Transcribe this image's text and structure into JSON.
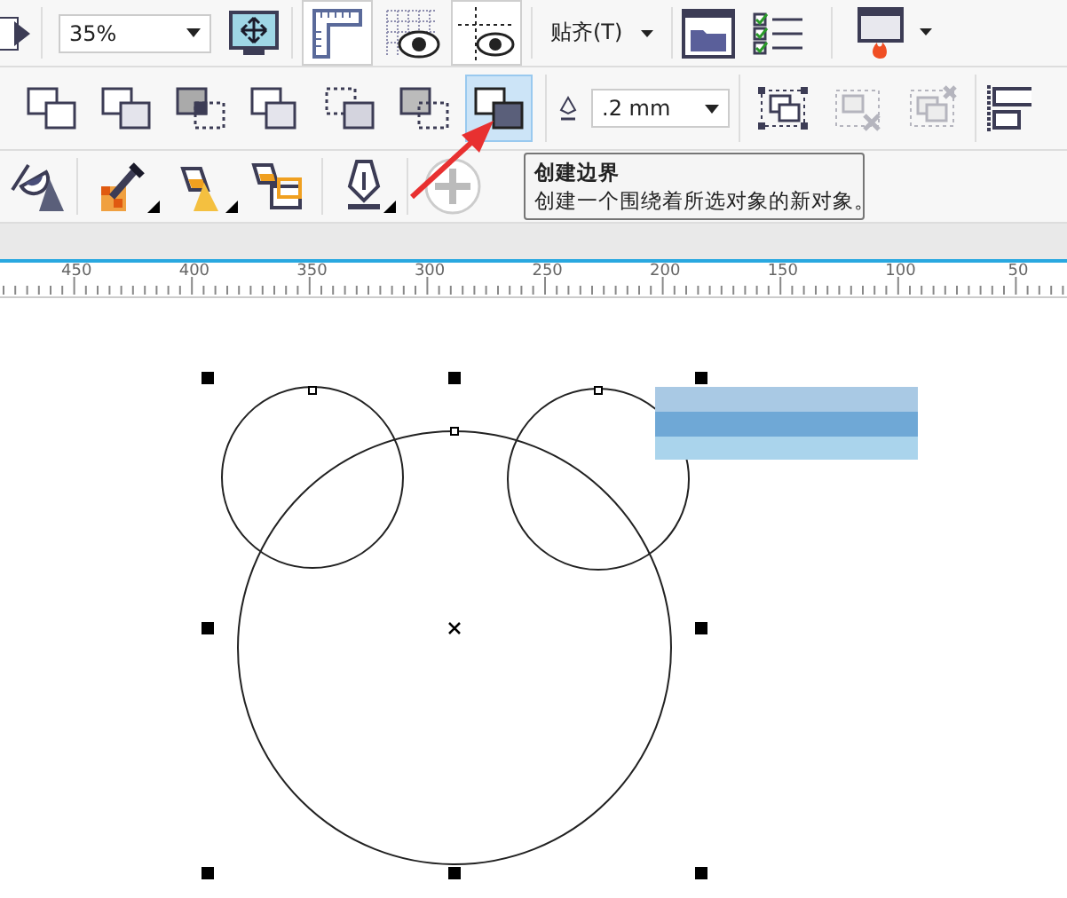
{
  "property_bar": {
    "zoom_field": {
      "value": "35%"
    },
    "view_toggles": [
      {
        "selected": true
      },
      {
        "selected": false
      },
      {
        "selected": true
      }
    ],
    "snap_menu": {
      "label": "贴齐(T)"
    }
  },
  "shaping_bar": {
    "shape_tools": [
      {
        "selected": false
      },
      {
        "selected": false
      },
      {
        "selected": false
      },
      {
        "selected": false
      },
      {
        "selected": false
      },
      {
        "selected": false
      },
      {
        "selected": true
      }
    ],
    "outline_width": {
      "value": ".2 mm"
    },
    "align_tools": [
      {
        "disabled": false
      },
      {
        "disabled": true
      },
      {
        "disabled": true
      }
    ]
  },
  "tooltip": {
    "title": "创建边界",
    "description": "创建一个围绕着所选对象的新对象。"
  },
  "ruler": {
    "labels": [
      "450",
      "400",
      "350",
      "300",
      "250",
      "200",
      "150",
      "100",
      "50"
    ]
  }
}
